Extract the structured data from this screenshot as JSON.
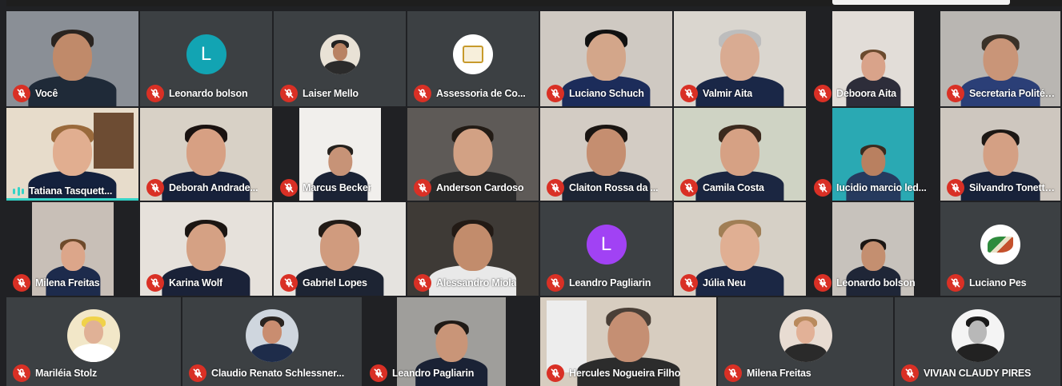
{
  "meeting": {
    "colors": {
      "background": "#202124",
      "tile": "#3c4043",
      "muted_icon": "#d93025",
      "speaking_accent": "#34d3c7"
    },
    "tiles": [
      {
        "name": "Você",
        "muted": true,
        "kind": "camera",
        "bg": "#8a8f96",
        "skin": "#c08a6a",
        "hair": "#2a2420",
        "shirt": "#1f2a38"
      },
      {
        "name": "Leonardo bolson",
        "muted": true,
        "kind": "letter",
        "letter": "L",
        "avatar_color": "#12a4b3"
      },
      {
        "name": "Laiser Mello",
        "muted": true,
        "kind": "photo",
        "photo_bg": "#e9e2d6",
        "skin": "#b88263",
        "shirt": "#2b2b2b"
      },
      {
        "name": "Assessoria de Co...",
        "muted": true,
        "kind": "logo",
        "photo_bg": "#ffffff",
        "logo_color": "#c79a2c"
      },
      {
        "name": "Luciano Schuch",
        "muted": true,
        "kind": "camera",
        "bg": "#cfc9c2",
        "skin": "#d3a68a",
        "hair": "#111111",
        "shirt": "#1c2c5a"
      },
      {
        "name": "Valmir Aita",
        "muted": true,
        "kind": "camera",
        "bg": "#dad6cf",
        "skin": "#d9ab92",
        "hair": "#bdbdbd",
        "shirt": "#1a2747"
      },
      {
        "name": "Deboora Aita",
        "muted": true,
        "kind": "camera",
        "bg": "#e2ddd8",
        "skin": "#d9a38a",
        "hair": "#6b4a2e",
        "shirt": "#2d2d3a",
        "narrow": true
      },
      {
        "name": "Secretaria Politéc...",
        "muted": true,
        "kind": "camera",
        "bg": "#b9b6b2",
        "skin": "#c99578",
        "hair": "#3a3128",
        "shirt": "#2b3f77"
      },
      {
        "name": "Tatiana Tasquett...",
        "muted": false,
        "speaking": true,
        "kind": "camera",
        "bg": "#e7dccb",
        "skin": "#e1ae90",
        "hair": "#9a6a3c",
        "shirt": "#14213d",
        "shelf": true
      },
      {
        "name": "Deborah Andrade...",
        "muted": true,
        "kind": "camera",
        "bg": "#d8d1c6",
        "skin": "#d7a083",
        "hair": "#1a1210",
        "shirt": "#17213b"
      },
      {
        "name": "Marcus Becker",
        "muted": true,
        "kind": "camera",
        "bg": "#f1efec",
        "skin": "#c79377",
        "hair": "#25211d",
        "shirt": "#1b2335",
        "narrow": true
      },
      {
        "name": "Anderson Cardoso",
        "muted": true,
        "kind": "camera",
        "bg": "#5e5a57",
        "skin": "#d2a184",
        "hair": "#231c16",
        "shirt": "#2a2a2a"
      },
      {
        "name": "Claiton Rossa da ...",
        "muted": true,
        "kind": "camera",
        "bg": "#d3ccc4",
        "skin": "#c58e70",
        "hair": "#1a1512",
        "shirt": "#1d2535"
      },
      {
        "name": "Camila Costa",
        "muted": true,
        "kind": "camera",
        "bg": "#cfd3c4",
        "skin": "#d6a184",
        "hair": "#3c2a1e",
        "shirt": "#1b2641"
      },
      {
        "name": "Iucidio marcio led...",
        "muted": true,
        "kind": "camera",
        "bg": "#2aa9b3",
        "skin": "#b98060",
        "hair": "#3a2b20",
        "shirt": "#263a5e",
        "narrow": true
      },
      {
        "name": "Silvandro Tonetto...",
        "muted": true,
        "kind": "camera",
        "bg": "#cec7bf",
        "skin": "#d4a084",
        "hair": "#1c1714",
        "shirt": "#18223a"
      },
      {
        "name": "Milena Freitas",
        "muted": true,
        "kind": "camera",
        "bg": "#c8bfb7",
        "skin": "#dca68a",
        "hair": "#6e4a2b",
        "shirt": "#1d2b4c",
        "narrow": true
      },
      {
        "name": "Karina Wolf",
        "muted": true,
        "kind": "camera",
        "bg": "#e6e1db",
        "skin": "#d5a184",
        "hair": "#1b1512",
        "shirt": "#1a2238"
      },
      {
        "name": "Gabriel Lopes",
        "muted": true,
        "kind": "camera",
        "bg": "#e5e3df",
        "skin": "#d09b7e",
        "hair": "#221b16",
        "shirt": "#1d2433"
      },
      {
        "name": "Alessandro Miola",
        "muted": true,
        "kind": "camera",
        "bg": "#3e3a36",
        "skin": "#c28c6c",
        "hair": "#221a15",
        "shirt": "#e9e9e9"
      },
      {
        "name": "Leandro Pagliarin",
        "muted": true,
        "kind": "letter",
        "letter": "L",
        "avatar_color": "#a142f4"
      },
      {
        "name": "Júlia Neu",
        "muted": true,
        "kind": "camera",
        "bg": "#d6d0c6",
        "skin": "#e0af93",
        "hair": "#a07e55",
        "shirt": "#1b2744"
      },
      {
        "name": "Leonardo bolson",
        "muted": true,
        "kind": "camera",
        "bg": "#c7c2bc",
        "skin": "#c48f70",
        "hair": "#1b1613",
        "shirt": "#1f2637",
        "narrow": true
      },
      {
        "name": "Luciano Pes",
        "muted": true,
        "kind": "logo2",
        "photo_bg": "#ffffff"
      },
      {
        "name": "Mariléia Stolz",
        "muted": true,
        "kind": "photo",
        "photo_bg": "#f2e7c8",
        "skin": "#e0b196",
        "shirt": "#ffffff",
        "hair": "#f0d24a"
      },
      {
        "name": "Claudio Renato Schlessner...",
        "muted": true,
        "kind": "photo",
        "photo_bg": "#cfd6de",
        "skin": "#c98d70",
        "shirt": "#1e2c4a",
        "hair": "#2a2420"
      },
      {
        "name": "Leandro Pagliarin",
        "muted": true,
        "kind": "camera",
        "bg": "#9f9e9b",
        "skin": "#c99578",
        "hair": "#1f1a16",
        "shirt": "#1a2235",
        "narrow": true
      },
      {
        "name": "Hercules Nogueira Filho",
        "muted": true,
        "kind": "camera",
        "bg": "#d7cdc0",
        "skin": "#c58f73",
        "hair": "#4a3f37",
        "shirt": "#2c2c2c",
        "doorway": true
      },
      {
        "name": "Milena Freitas",
        "muted": true,
        "kind": "photo",
        "photo_bg": "#e8dcd2",
        "skin": "#e2b197",
        "shirt": "#2a2a2a",
        "hair": "#b98a5d"
      },
      {
        "name": "VIVIAN CLAUDY PIRES",
        "muted": true,
        "kind": "photo",
        "photo_bg": "#f4f4f4",
        "skin": "#d7b29b",
        "shirt": "#222222",
        "hair": "#1a1a1a",
        "bw": true
      }
    ]
  }
}
